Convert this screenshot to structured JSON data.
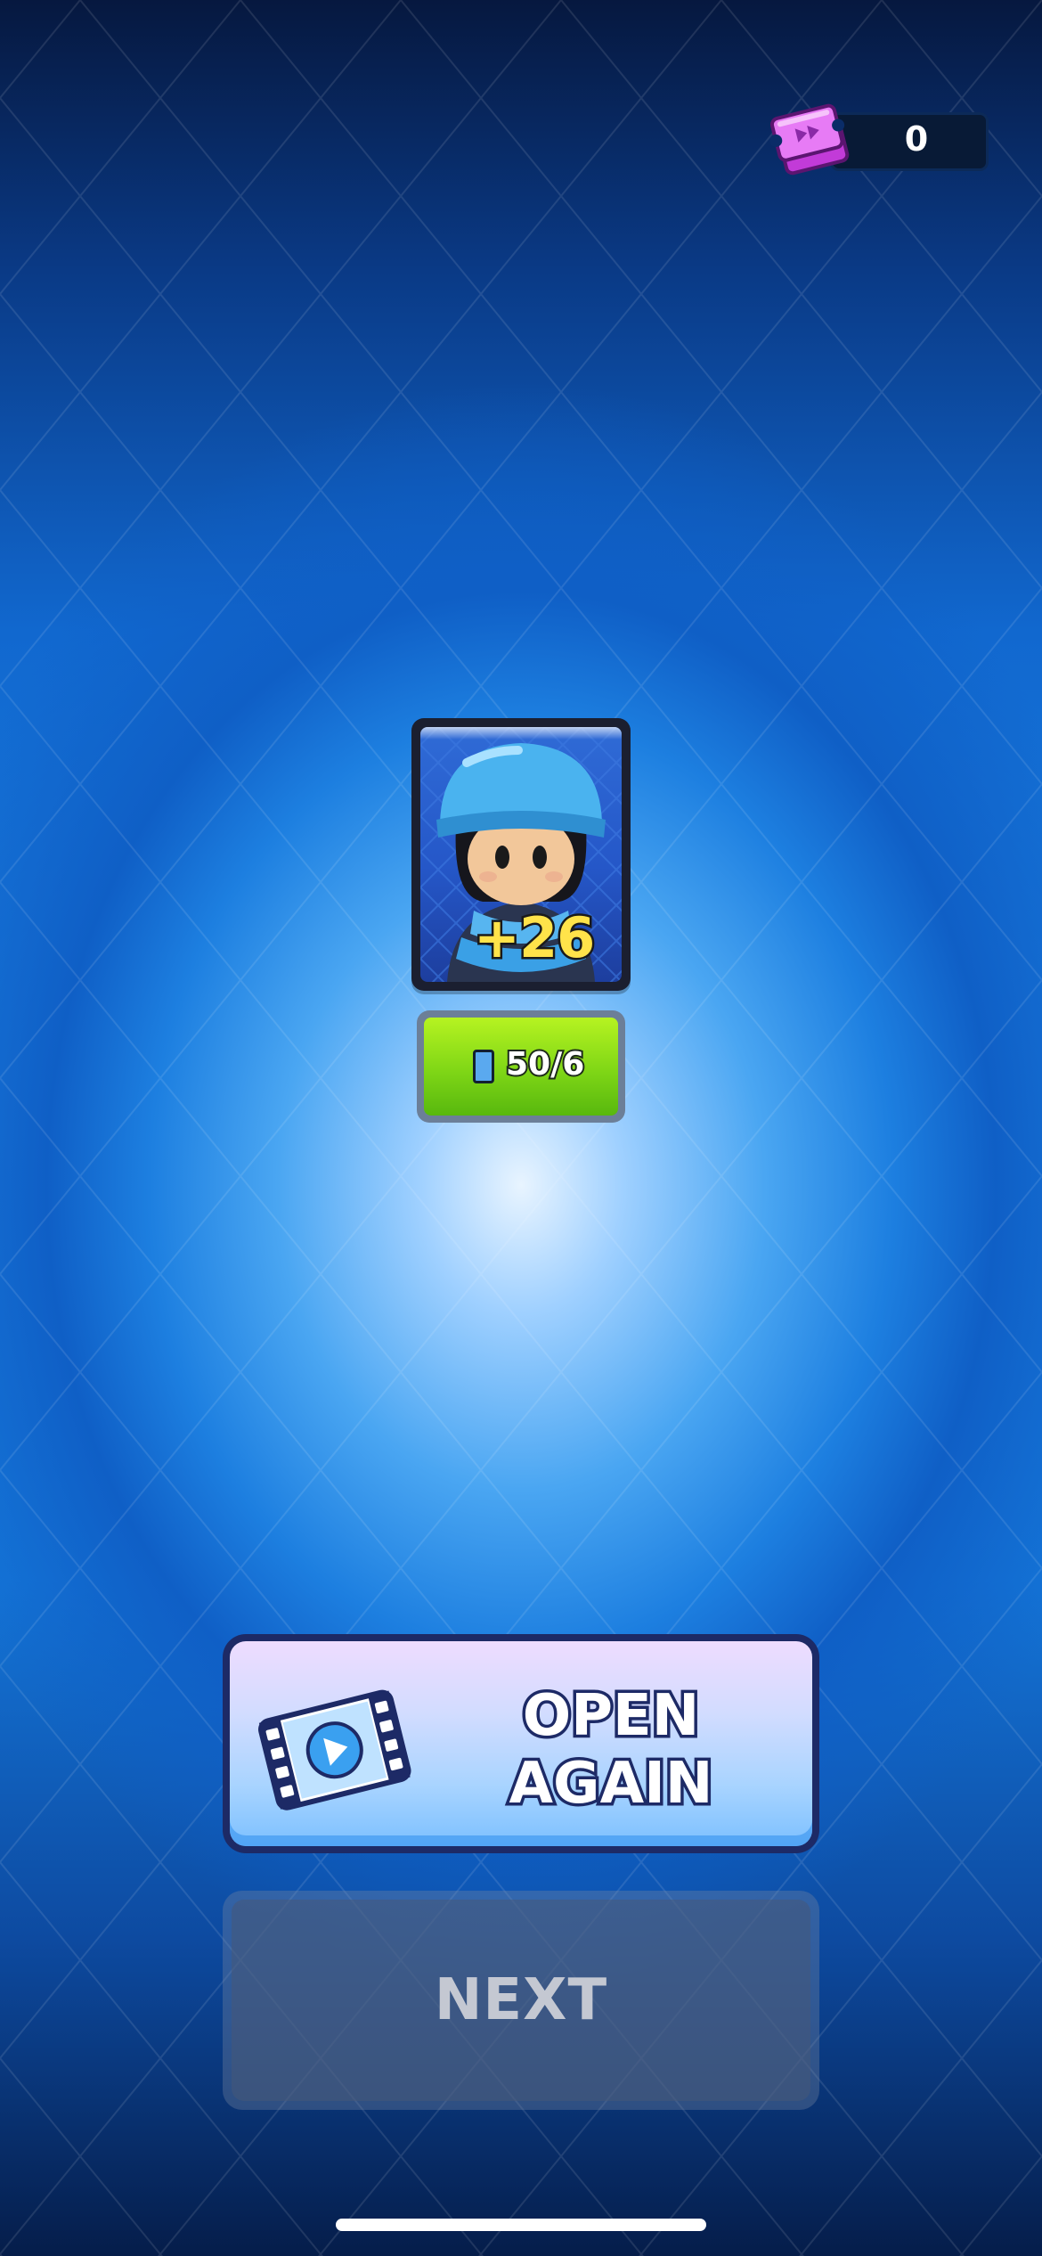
{
  "currency": {
    "icon": "ticket-icon",
    "value": "0"
  },
  "reward_card": {
    "character": "blue-helmet-soldier",
    "count_label": "+26"
  },
  "card_progress": {
    "icon": "card-icon",
    "label": "50/6"
  },
  "buttons": {
    "open_again_line1": "OPEN",
    "open_again_line2": "AGAIN",
    "open_again_icon": "video-ad-icon",
    "next_label": "NEXT"
  },
  "colors": {
    "progress_fill": "#7fd616",
    "button_border": "#1d2a66",
    "count_text": "#ffe34a"
  }
}
